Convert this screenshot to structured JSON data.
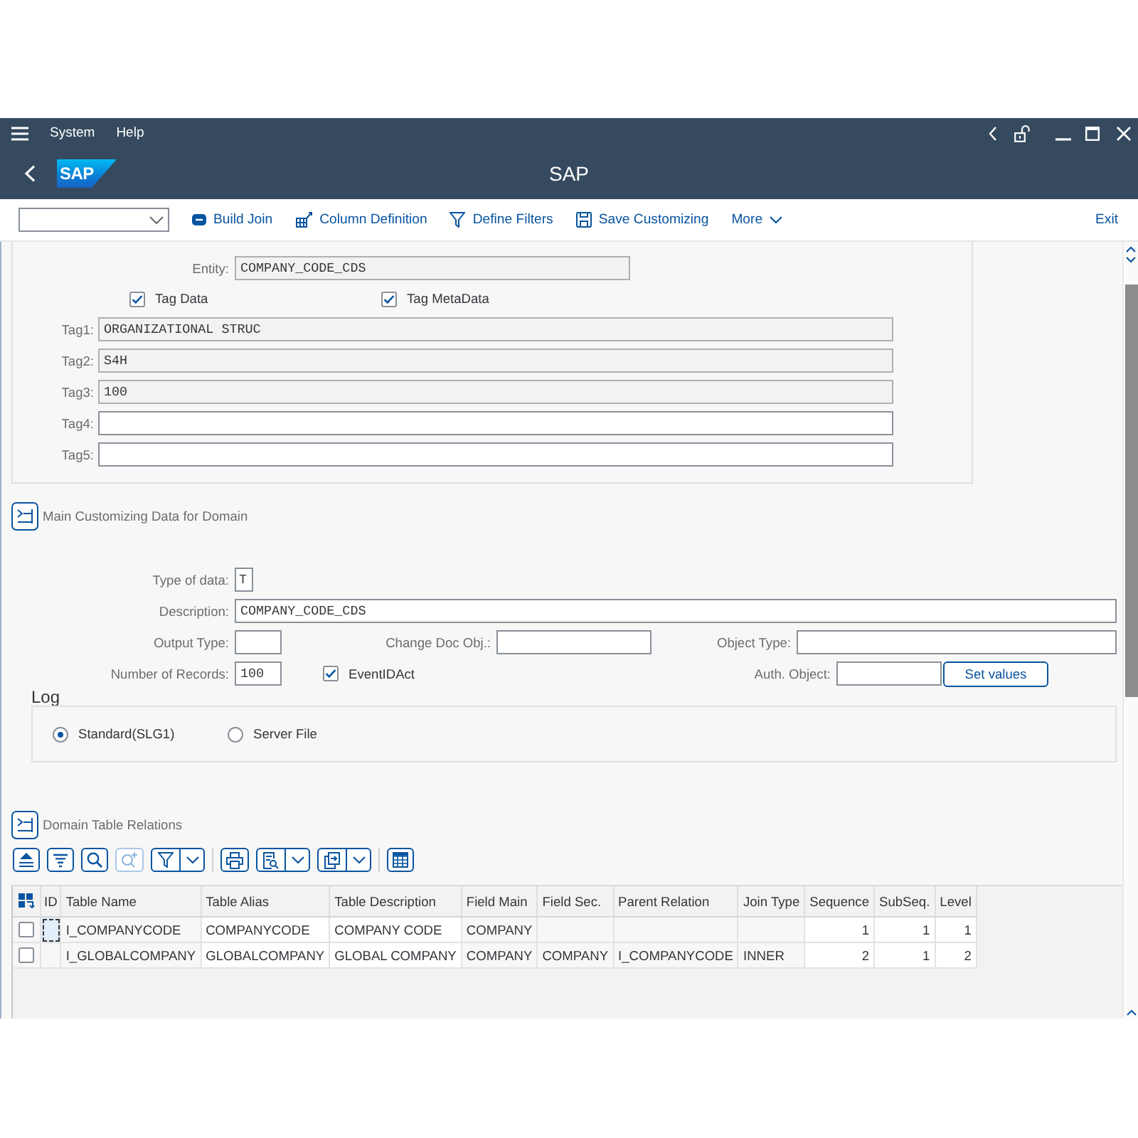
{
  "window": {
    "menu": [
      {
        "label": "System"
      },
      {
        "label": "Help"
      }
    ],
    "logo": "SAP",
    "title": "SAP"
  },
  "toolbar": {
    "buttons": [
      {
        "kind": "join",
        "label": "Build Join"
      },
      {
        "kind": "columns",
        "label": "Column Definition"
      },
      {
        "kind": "filter",
        "label": "Define Filters"
      },
      {
        "kind": "save",
        "label": "Save Customizing"
      }
    ],
    "more": "More",
    "exit": "Exit"
  },
  "entity_panel": {
    "entity": {
      "label": "Entity:",
      "value": "COMPANY_CODE_CDS",
      "readonly": true
    },
    "checkboxes": [
      {
        "label": "Tag Data",
        "checked": true
      },
      {
        "label": "Tag MetaData",
        "checked": true
      }
    ],
    "tags": [
      {
        "label": "Tag1:",
        "value": "ORGANIZATIONAL STRUC",
        "readonly": true
      },
      {
        "label": "Tag2:",
        "value": "S4H",
        "readonly": true
      },
      {
        "label": "Tag3:",
        "value": "100",
        "readonly": true
      },
      {
        "label": "Tag4:",
        "readonly": false
      },
      {
        "label": "Tag5:",
        "readonly": false
      }
    ]
  },
  "main_section": {
    "title": "Main Customizing Data for Domain",
    "type_of_data": {
      "label": "Type of data:",
      "value": "T"
    },
    "description": {
      "label": "Description:",
      "value": "COMPANY_CODE_CDS"
    },
    "output_type": {
      "label": "Output Type:"
    },
    "change_doc_obj": {
      "label": "Change Doc Obj.:"
    },
    "object_type": {
      "label": "Object Type:"
    },
    "number_of_records": {
      "label": "Number of Records:",
      "value": "100"
    },
    "event_id_act": {
      "label": "EventIDAct",
      "checked": true
    },
    "auth_object": {
      "label": "Auth. Object:"
    },
    "set_values_button": "Set values"
  },
  "log": {
    "title": "Log",
    "options": [
      {
        "label": "Standard(SLG1)",
        "selected": true
      },
      {
        "label": "Server File",
        "selected": false
      }
    ]
  },
  "table_section": {
    "title": "Domain Table Relations",
    "toolbar": [
      {
        "kind": "sort_asc",
        "disabled": false
      },
      {
        "kind": "sort_desc",
        "disabled": false
      },
      {
        "kind": "find",
        "disabled": false
      },
      {
        "kind": "find_next",
        "disabled": true
      },
      {
        "kind": "filter",
        "disabled": false
      },
      {
        "kind": "print",
        "disabled": false
      },
      {
        "kind": "layout",
        "disabled": false
      },
      {
        "kind": "export",
        "disabled": false
      },
      {
        "kind": "grid",
        "disabled": false
      }
    ],
    "columns": [
      "ID",
      "Table Name",
      "Table Alias",
      "Table Description",
      "Field Main",
      "Field Sec.",
      "Parent Relation",
      "Join Type",
      "Sequence",
      "SubSeq.",
      "Level"
    ],
    "rows": [
      {
        "checked": false,
        "focused": true,
        "table_name": "I_COMPANYCODE",
        "table_alias": "COMPANYCODE",
        "table_description": "COMPANY CODE",
        "field_main": "COMPANY",
        "sequence": "1",
        "subseq": "1",
        "lvl": "1"
      },
      {
        "checked": false,
        "focused": false,
        "table_name": "I_GLOBALCOMPANY",
        "table_alias": "GLOBALCOMPANY",
        "table_description": "GLOBAL COMPANY",
        "field_main": "COMPANY",
        "field_sec": "COMPANY",
        "parent_relation": "I_COMPANYCODE",
        "join_type": "INNER",
        "sequence": "2",
        "subseq": "1",
        "lvl": "2"
      }
    ]
  }
}
